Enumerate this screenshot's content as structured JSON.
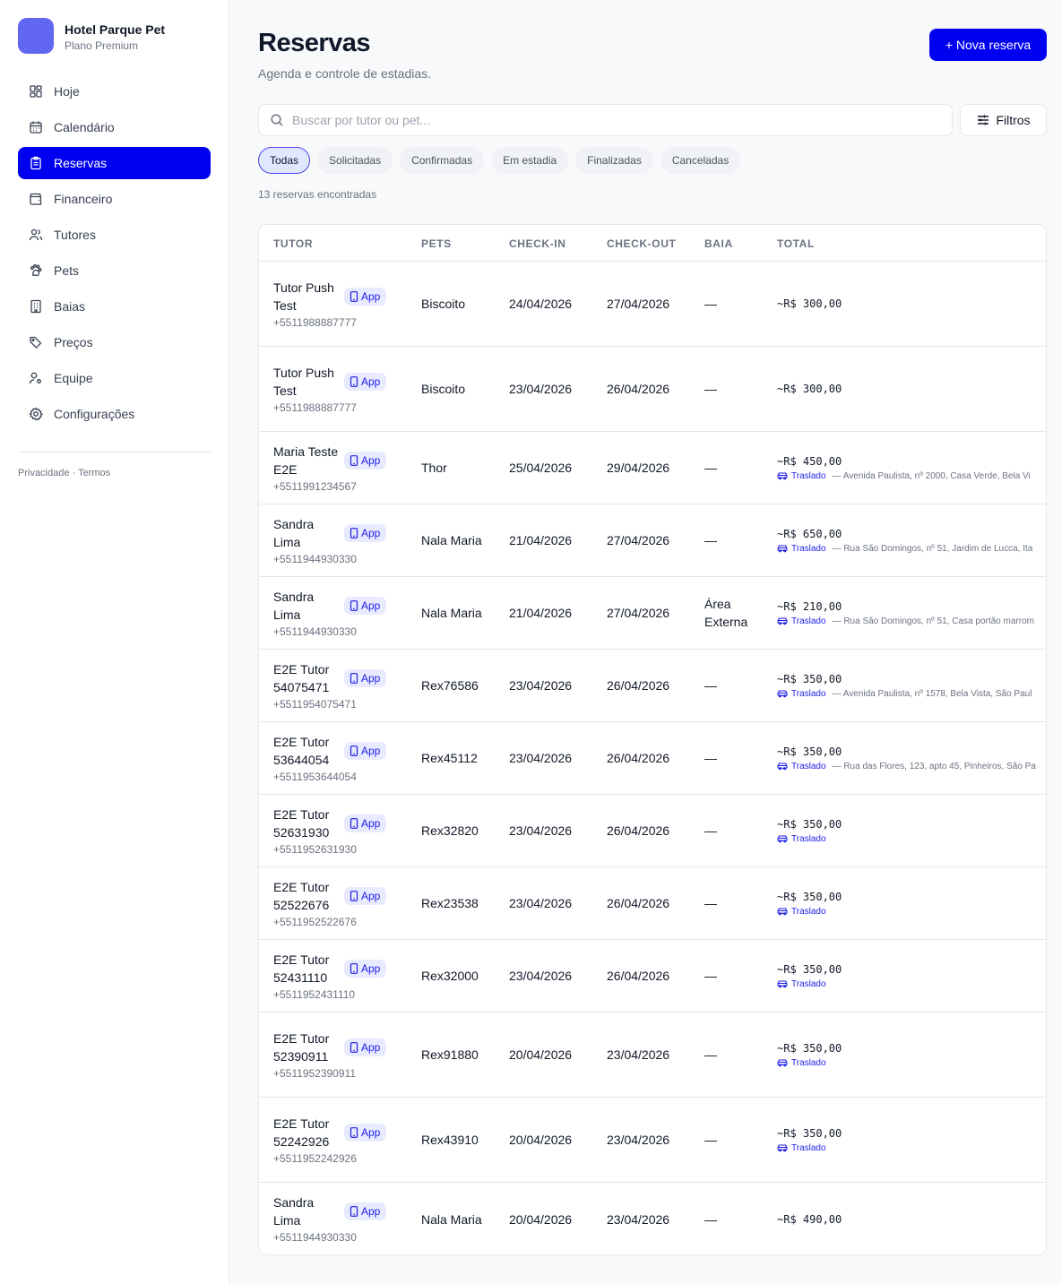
{
  "sidebar": {
    "brand_name": "Hotel Parque Pet",
    "brand_plan": "Plano Premium",
    "items": [
      {
        "label": "Hoje",
        "icon": "dashboard-icon"
      },
      {
        "label": "Calendário",
        "icon": "calendar-icon"
      },
      {
        "label": "Reservas",
        "icon": "clipboard-icon",
        "active": true
      },
      {
        "label": "Financeiro",
        "icon": "wallet-icon"
      },
      {
        "label": "Tutores",
        "icon": "users-icon"
      },
      {
        "label": "Pets",
        "icon": "paw-icon"
      },
      {
        "label": "Baias",
        "icon": "building-icon"
      },
      {
        "label": "Preços",
        "icon": "tag-icon"
      },
      {
        "label": "Equipe",
        "icon": "user-cog-icon"
      },
      {
        "label": "Configurações",
        "icon": "gear-icon"
      }
    ],
    "footer": {
      "privacy": "Privacidade",
      "separator": "·",
      "terms": "Termos"
    }
  },
  "header": {
    "title": "Reservas",
    "subtitle": "Agenda e controle de estadias.",
    "new_button": "+ Nova reserva"
  },
  "search": {
    "placeholder": "Buscar por tutor ou pet...",
    "value": ""
  },
  "filters_button": "Filtros",
  "chips": [
    "Todas",
    "Solicitadas",
    "Confirmadas",
    "Em estadia",
    "Finalizadas",
    "Canceladas"
  ],
  "active_chip": "Todas",
  "result_count": "13 reservas encontradas",
  "table": {
    "columns": [
      "TUTOR",
      "PETS",
      "CHECK-IN",
      "CHECK-OUT",
      "BAIA",
      "TOTAL"
    ],
    "app_badge": "App",
    "rows": [
      {
        "name": "Tutor Push Test",
        "phone": "+5511988887777",
        "pets": "Biscoito",
        "checkin": "24/04/2026",
        "checkout": "27/04/2026",
        "baia": "—",
        "total": "~R$ 300,00",
        "transfer": "",
        "address": ""
      },
      {
        "name": "Tutor Push Test",
        "phone": "+5511988887777",
        "pets": "Biscoito",
        "checkin": "23/04/2026",
        "checkout": "26/04/2026",
        "baia": "—",
        "total": "~R$ 300,00",
        "transfer": "",
        "address": ""
      },
      {
        "name": "Maria Teste E2E",
        "phone": "+5511991234567",
        "pets": "Thor",
        "checkin": "25/04/2026",
        "checkout": "29/04/2026",
        "baia": "—",
        "total": "~R$ 450,00",
        "transfer": "Traslado",
        "address": "— Avenida Paulista, nº 2000, Casa Verde, Bela Vi"
      },
      {
        "name": "Sandra Lima",
        "phone": "+5511944930330",
        "pets": "Nala Maria",
        "checkin": "21/04/2026",
        "checkout": "27/04/2026",
        "baia": "—",
        "total": "~R$ 650,00",
        "transfer": "Traslado",
        "address": "— Rua São Domingos, nº 51, Jardim de Lucca, Ita"
      },
      {
        "name": "Sandra Lima",
        "phone": "+5511944930330",
        "pets": "Nala Maria",
        "checkin": "21/04/2026",
        "checkout": "27/04/2026",
        "baia": "Área Externa",
        "total": "~R$ 210,00",
        "transfer": "Traslado",
        "address": "— Rua São Domingos, nº 51, Casa portão marrom"
      },
      {
        "name": "E2E Tutor 54075471",
        "phone": "+5511954075471",
        "pets": "Rex76586",
        "checkin": "23/04/2026",
        "checkout": "26/04/2026",
        "baia": "—",
        "total": "~R$ 350,00",
        "transfer": "Traslado",
        "address": "— Avenida Paulista, nº 1578, Bela Vista, São Paul"
      },
      {
        "name": "E2E Tutor 53644054",
        "phone": "+5511953644054",
        "pets": "Rex45112",
        "checkin": "23/04/2026",
        "checkout": "26/04/2026",
        "baia": "—",
        "total": "~R$ 350,00",
        "transfer": "Traslado",
        "address": "— Rua das Flores, 123, apto 45, Pinheiros, São Pa"
      },
      {
        "name": "E2E Tutor 52631930",
        "phone": "+5511952631930",
        "pets": "Rex32820",
        "checkin": "23/04/2026",
        "checkout": "26/04/2026",
        "baia": "—",
        "total": "~R$ 350,00",
        "transfer": "Traslado",
        "address": ""
      },
      {
        "name": "E2E Tutor 52522676",
        "phone": "+5511952522676",
        "pets": "Rex23538",
        "checkin": "23/04/2026",
        "checkout": "26/04/2026",
        "baia": "—",
        "total": "~R$ 350,00",
        "transfer": "Traslado",
        "address": ""
      },
      {
        "name": "E2E Tutor 52431110",
        "phone": "+5511952431110",
        "pets": "Rex32000",
        "checkin": "23/04/2026",
        "checkout": "26/04/2026",
        "baia": "—",
        "total": "~R$ 350,00",
        "transfer": "Traslado",
        "address": ""
      },
      {
        "name": "E2E Tutor 52390911",
        "phone": "+5511952390911",
        "pets": "Rex91880",
        "checkin": "20/04/2026",
        "checkout": "23/04/2026",
        "baia": "—",
        "total": "~R$ 350,00",
        "transfer": "Traslado",
        "address": ""
      },
      {
        "name": "E2E Tutor 52242926",
        "phone": "+5511952242926",
        "pets": "Rex43910",
        "checkin": "20/04/2026",
        "checkout": "23/04/2026",
        "baia": "—",
        "total": "~R$ 350,00",
        "transfer": "Traslado",
        "address": ""
      },
      {
        "name": "Sandra Lima",
        "phone": "+5511944930330",
        "pets": "Nala Maria",
        "checkin": "20/04/2026",
        "checkout": "23/04/2026",
        "baia": "—",
        "total": "~R$ 490,00",
        "transfer": "",
        "address": ""
      }
    ]
  },
  "colors": {
    "accent": "#0000f0",
    "brand_logo": "#6366f1",
    "badge_bg": "#e8eaff",
    "badge_text": "#1e1ee8"
  }
}
